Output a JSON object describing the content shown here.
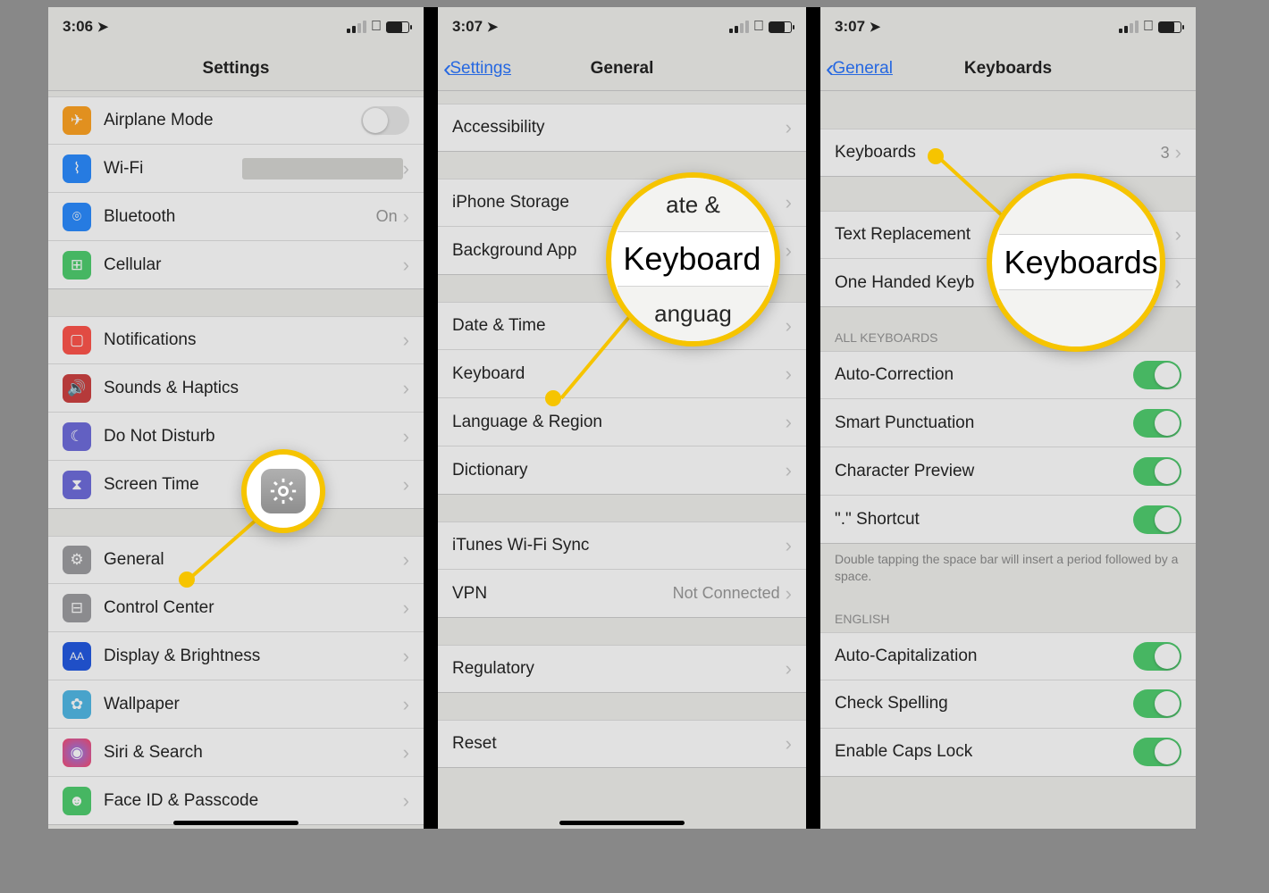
{
  "phone1": {
    "time": "3:06",
    "title": "Settings",
    "rows": {
      "airplane": "Airplane Mode",
      "wifi": "Wi-Fi",
      "bluetooth": "Bluetooth",
      "bluetooth_val": "On",
      "cellular": "Cellular",
      "notifications": "Notifications",
      "sounds": "Sounds & Haptics",
      "dnd": "Do Not Disturb",
      "screentime": "Screen Time",
      "general": "General",
      "control": "Control Center",
      "display": "Display & Brightness",
      "wallpaper": "Wallpaper",
      "siri": "Siri & Search",
      "faceid": "Face ID & Passcode"
    }
  },
  "phone2": {
    "time": "3:07",
    "back": "Settings",
    "title": "General",
    "rows": {
      "accessibility": "Accessibility",
      "iphone_storage": "iPhone Storage",
      "background": "Background App",
      "date": "Date & Time",
      "keyboard": "Keyboard",
      "language": "Language & Region",
      "dictionary": "Dictionary",
      "itunes": "iTunes Wi-Fi Sync",
      "vpn": "VPN",
      "vpn_val": "Not Connected",
      "regulatory": "Regulatory",
      "reset": "Reset"
    },
    "mag_top": "ate &",
    "mag_mid": "Keyboard",
    "mag_bot": "anguag"
  },
  "phone3": {
    "time": "3:07",
    "back": "General",
    "title": "Keyboards",
    "rows": {
      "keyboards": "Keyboards",
      "keyboards_val": "3",
      "text_rep": "Text Replacement",
      "one_handed": "One Handed Keyb",
      "auto_corr": "Auto-Correction",
      "smart_punc": "Smart Punctuation",
      "char_prev": "Character Preview",
      "shortcut": "\".\" Shortcut",
      "auto_cap": "Auto-Capitalization",
      "spell": "Check Spelling",
      "caps": "Enable Caps Lock"
    },
    "section_all": "ALL KEYBOARDS",
    "section_eng": "ENGLISH",
    "footer": "Double tapping the space bar will insert a period followed by a space.",
    "mag": "Keyboards"
  },
  "colors": {
    "orange": "#ff9500",
    "blue": "#0a79ff",
    "green": "#34c759",
    "red": "#ff3b30",
    "indigo": "#5856d6",
    "gray": "#8e8e93",
    "dblue": "#0040dd",
    "pink": "#ff2d55",
    "darkred": "#c62424"
  }
}
